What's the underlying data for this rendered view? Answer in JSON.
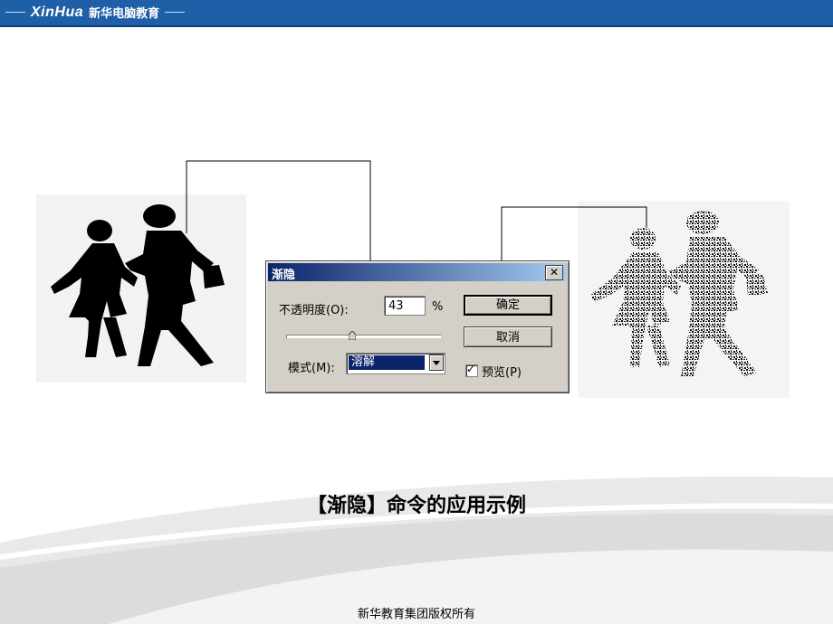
{
  "header": {
    "brand_latin": "XinHua",
    "brand_cn": "新华电脑教育"
  },
  "dialog": {
    "title": "渐隐",
    "close_glyph": "✕",
    "opacity_label": "不透明度(O):",
    "opacity_value": "43",
    "percent_sign": "%",
    "slider_value": 0.43,
    "mode_label": "模式(M):",
    "mode_value": "溶解",
    "ok_label": "确定",
    "cancel_label": "取消",
    "preview_label": "预览(P)",
    "preview_checked": true
  },
  "caption": "【渐隐】命令的应用示例",
  "footer": "新华教育集团版权所有",
  "colors": {
    "brand_bar": "#1f5fa8",
    "dialog_face": "#d4d0c8",
    "titlebar": "#0a246a"
  }
}
